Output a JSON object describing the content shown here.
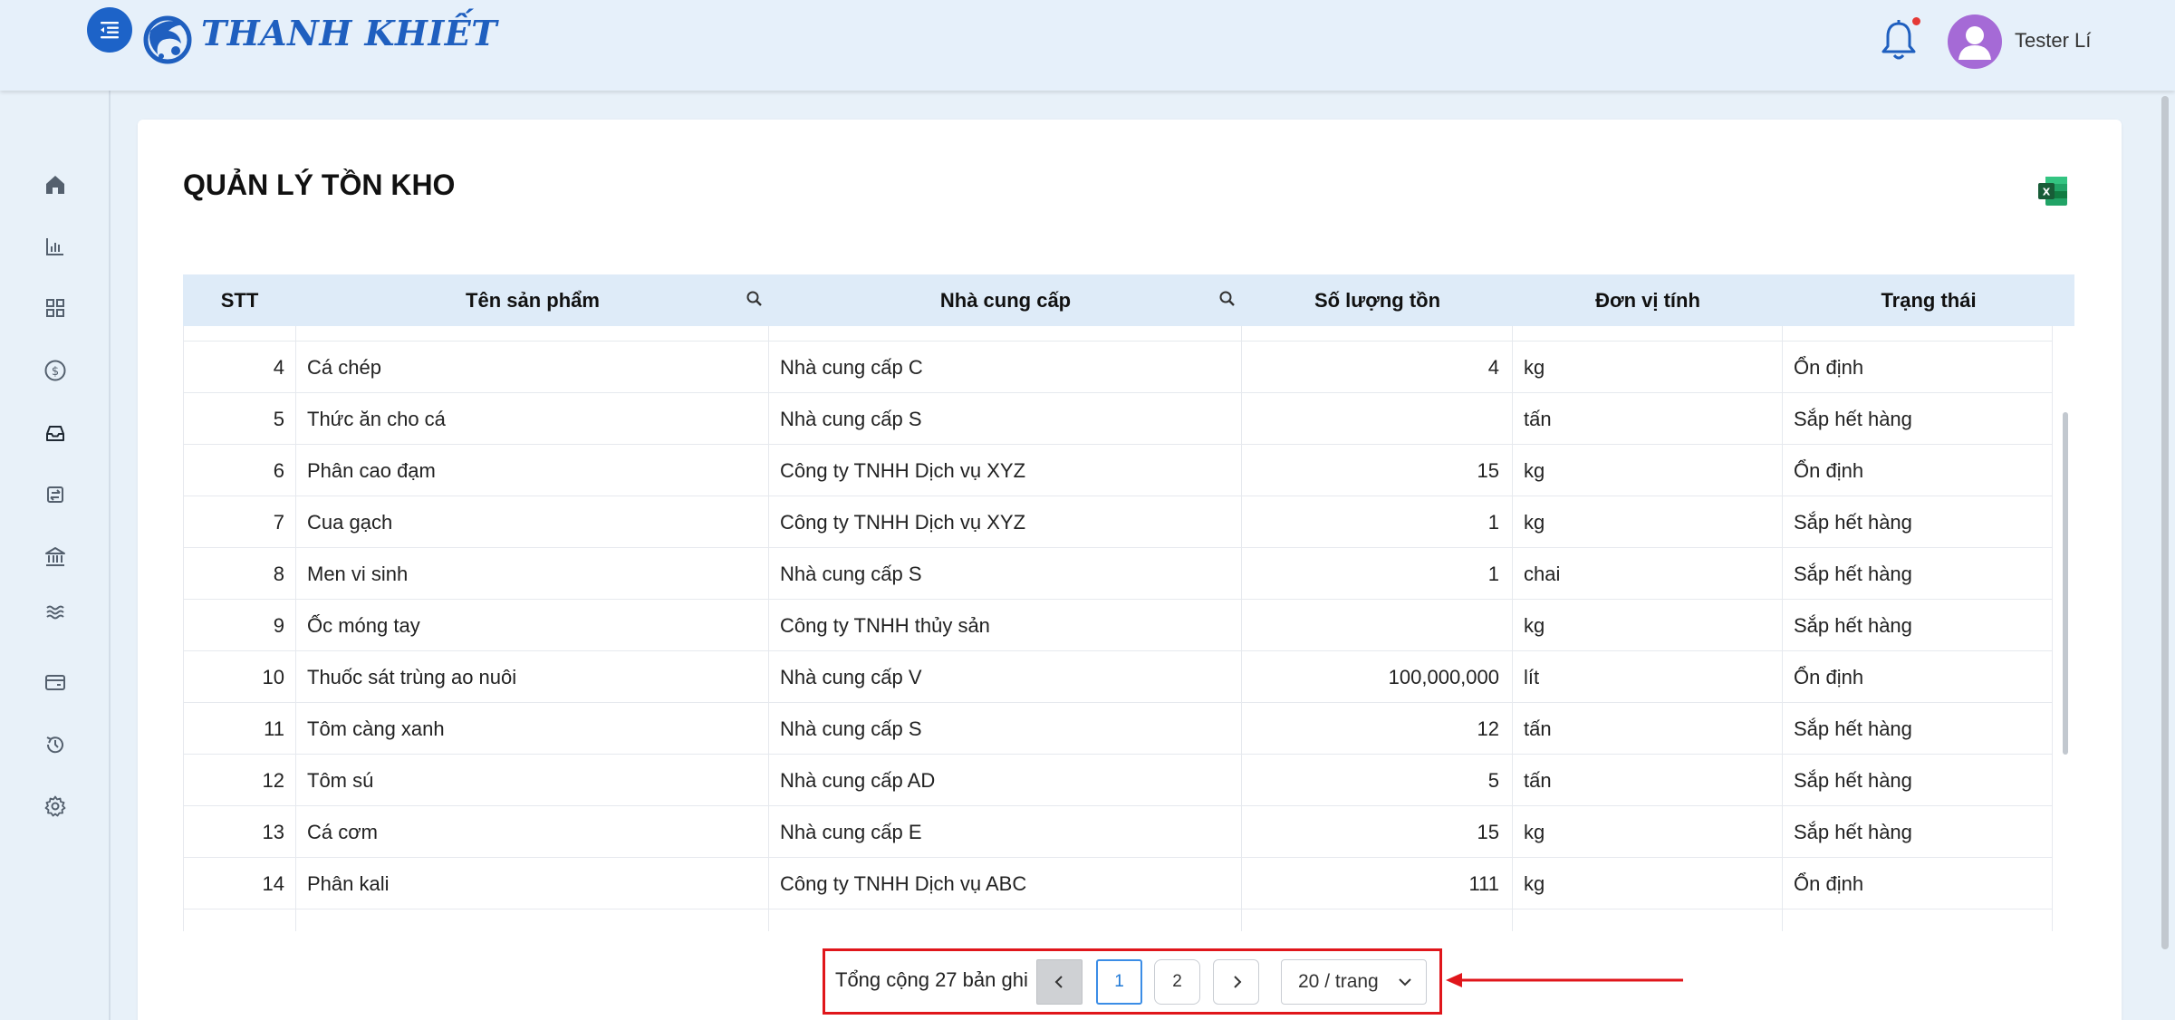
{
  "header": {
    "brand": "THANH KHIẾT",
    "user_name": "Tester Lí",
    "notification_badge_color": "#e53935",
    "accent_color": "#1d63c8"
  },
  "sidebar": {
    "items": [
      {
        "icon": "home-icon"
      },
      {
        "icon": "bar-chart-icon"
      },
      {
        "icon": "grid-icon"
      },
      {
        "icon": "dollar-icon"
      },
      {
        "icon": "inbox-icon"
      },
      {
        "icon": "transfer-icon"
      },
      {
        "icon": "bank-icon"
      },
      {
        "icon": "waves-icon"
      },
      {
        "icon": "wallet-icon"
      },
      {
        "icon": "history-icon"
      },
      {
        "icon": "settings-icon"
      }
    ]
  },
  "page": {
    "title": "QUẢN LÝ TỒN KHO"
  },
  "table": {
    "columns": [
      "STT",
      "Tên sản phẩm",
      "Nhà cung cấp",
      "Số lượng tồn",
      "Đơn vị tính",
      "Trạng thái"
    ],
    "rows": [
      {
        "stt": "4",
        "name": "Cá chép",
        "supplier": "Nhà cung cấp C",
        "qty": "4",
        "unit": "kg",
        "status": "Ổn định"
      },
      {
        "stt": "5",
        "name": "Thức ăn cho cá",
        "supplier": "Nhà cung cấp S",
        "qty": "",
        "unit": "tấn",
        "status": "Sắp hết hàng"
      },
      {
        "stt": "6",
        "name": "Phân cao đạm",
        "supplier": "Công ty TNHH Dịch vụ XYZ",
        "qty": "15",
        "unit": "kg",
        "status": "Ổn định"
      },
      {
        "stt": "7",
        "name": "Cua gạch",
        "supplier": "Công ty TNHH Dịch vụ XYZ",
        "qty": "1",
        "unit": "kg",
        "status": "Sắp hết hàng"
      },
      {
        "stt": "8",
        "name": "Men vi sinh",
        "supplier": "Nhà cung cấp S",
        "qty": "1",
        "unit": "chai",
        "status": "Sắp hết hàng"
      },
      {
        "stt": "9",
        "name": "Ốc móng tay",
        "supplier": "Công ty TNHH thủy sản",
        "qty": "",
        "unit": "kg",
        "status": "Sắp hết hàng"
      },
      {
        "stt": "10",
        "name": "Thuốc sát trùng ao nuôi",
        "supplier": "Nhà cung cấp V",
        "qty": "100,000,000",
        "unit": "lít",
        "status": "Ổn định"
      },
      {
        "stt": "11",
        "name": "Tôm càng xanh",
        "supplier": "Nhà cung cấp S",
        "qty": "12",
        "unit": "tấn",
        "status": "Sắp hết hàng"
      },
      {
        "stt": "12",
        "name": "Tôm sú",
        "supplier": "Nhà cung cấp AD",
        "qty": "5",
        "unit": "tấn",
        "status": "Sắp hết hàng"
      },
      {
        "stt": "13",
        "name": "Cá cơm",
        "supplier": "Nhà cung cấp E",
        "qty": "15",
        "unit": "kg",
        "status": "Sắp hết hàng"
      },
      {
        "stt": "14",
        "name": "Phân kali",
        "supplier": "Công ty TNHH Dịch vụ ABC",
        "qty": "111",
        "unit": "kg",
        "status": "Ổn định"
      }
    ]
  },
  "pagination": {
    "total_text": "Tổng cộng 27 bản ghi",
    "prev_label": "<",
    "pages": [
      "1",
      "2"
    ],
    "current_page": "1",
    "next_label": ">",
    "page_size": "20 / trang"
  },
  "annotation": {
    "highlight_color": "#e0161b"
  }
}
